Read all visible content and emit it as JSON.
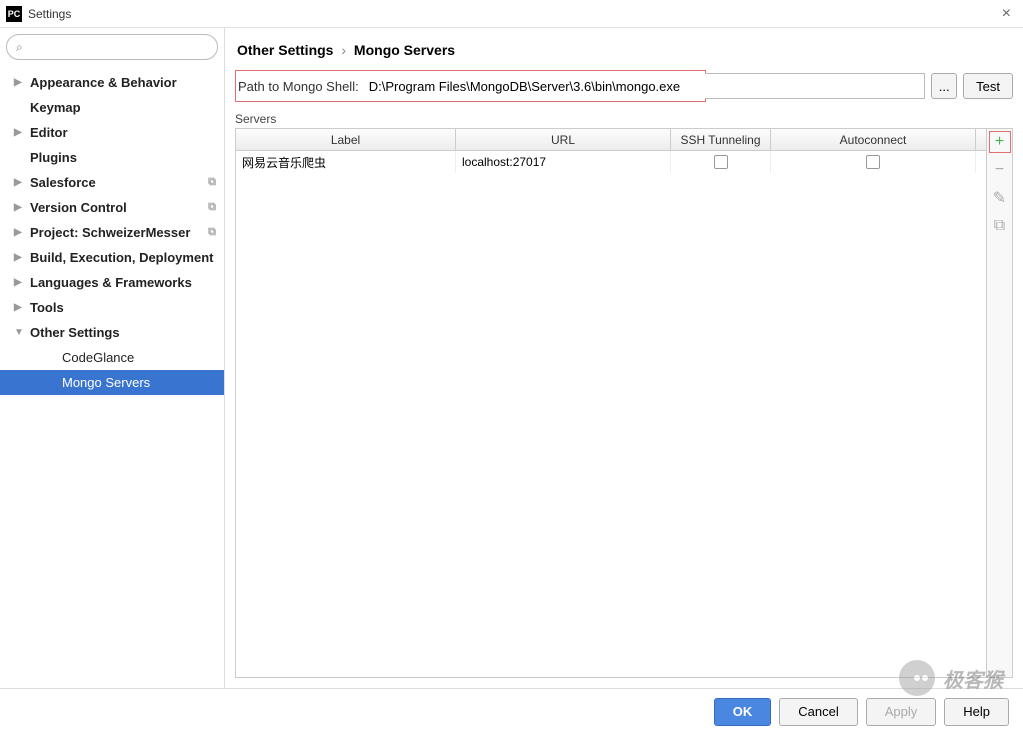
{
  "titlebar": {
    "app_icon": "PC",
    "title": "Settings",
    "close": "×"
  },
  "sidebar": {
    "search_placeholder": "",
    "items": [
      {
        "label": "Appearance & Behavior",
        "arrow": "▶",
        "bold": true
      },
      {
        "label": "Keymap",
        "arrow": "",
        "bold": true
      },
      {
        "label": "Editor",
        "arrow": "▶",
        "bold": true
      },
      {
        "label": "Plugins",
        "arrow": "",
        "bold": true
      },
      {
        "label": "Salesforce",
        "arrow": "▶",
        "bold": true,
        "copy": true
      },
      {
        "label": "Version Control",
        "arrow": "▶",
        "bold": true,
        "copy": true
      },
      {
        "label": "Project: SchweizerMesser",
        "arrow": "▶",
        "bold": true,
        "copy": true
      },
      {
        "label": "Build, Execution, Deployment",
        "arrow": "▶",
        "bold": true
      },
      {
        "label": "Languages & Frameworks",
        "arrow": "▶",
        "bold": true
      },
      {
        "label": "Tools",
        "arrow": "▶",
        "bold": true
      },
      {
        "label": "Other Settings",
        "arrow": "▼",
        "bold": true
      },
      {
        "label": "CodeGlance",
        "arrow": "",
        "child": true
      },
      {
        "label": "Mongo Servers",
        "arrow": "",
        "child": true,
        "selected": true
      }
    ]
  },
  "breadcrumb": {
    "parent": "Other Settings",
    "sep": "›",
    "current": "Mongo Servers"
  },
  "path": {
    "label": "Path to Mongo Shell:",
    "value": "D:\\Program Files\\MongoDB\\Server\\3.6\\bin\\mongo.exe",
    "browse": "...",
    "test": "Test"
  },
  "servers": {
    "label": "Servers",
    "columns": {
      "label": "Label",
      "url": "URL",
      "ssh": "SSH Tunneling",
      "auto": "Autoconnect"
    },
    "rows": [
      {
        "label": "网易云音乐爬虫",
        "url": "localhost:27017",
        "ssh": false,
        "auto": false
      }
    ],
    "toolbar": {
      "add": "+",
      "remove": "−",
      "edit": "✎",
      "copy": "⧉"
    }
  },
  "buttons": {
    "ok": "OK",
    "cancel": "Cancel",
    "apply": "Apply",
    "help": "Help"
  },
  "watermark": "极客猴"
}
